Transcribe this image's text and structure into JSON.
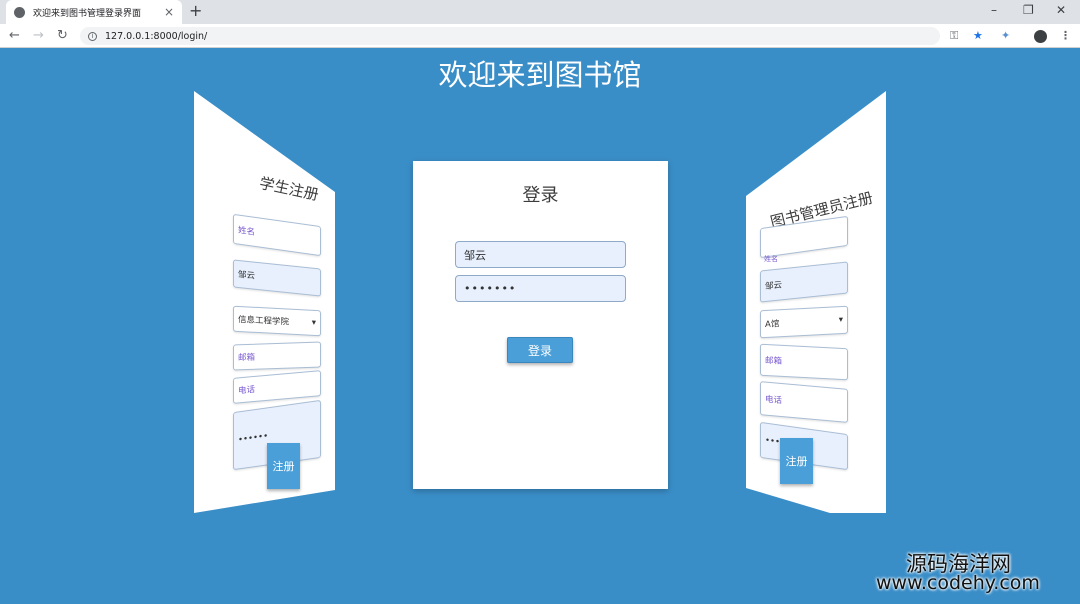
{
  "browser": {
    "tab_title": "欢迎来到图书管理登录界面",
    "url": "127.0.0.1:8000/login/",
    "new_tab": "+",
    "tab_close": "×",
    "win_min": "–",
    "win_max": "❐",
    "win_close": "✕",
    "nav_back": "←",
    "nav_forward": "→",
    "nav_reload": "↻",
    "key": "⚿",
    "star": "★",
    "ext": "✦",
    "menu": "⋮",
    "info": "i"
  },
  "page": {
    "title": "欢迎来到图书馆"
  },
  "login": {
    "title": "登录",
    "username_value": "邹云",
    "password_value": "•••••••",
    "button": "登录"
  },
  "student_register": {
    "title": "学生注册",
    "name_placeholder": "姓名",
    "name_value": "邹云",
    "college_value": "信息工程学院",
    "college_arrow": "▾",
    "email_placeholder": "邮箱",
    "phone_placeholder": "电话",
    "password_value": "••••••",
    "button": "注册"
  },
  "admin_register": {
    "title": "图书管理员注册",
    "field1_placeholder": "姓名",
    "field2_value": "邹云",
    "select_value": "A馆",
    "select_arrow": "▾",
    "email_placeholder": "邮箱",
    "phone_placeholder": "电话",
    "password_value": "•••••",
    "button": "注册"
  },
  "watermark": {
    "cn": "源码海洋网",
    "url": "www.codehy.com"
  },
  "colors": {
    "background": "#3a8ec8",
    "button": "#4a9fd8",
    "input_fill": "#e8f0fe"
  }
}
